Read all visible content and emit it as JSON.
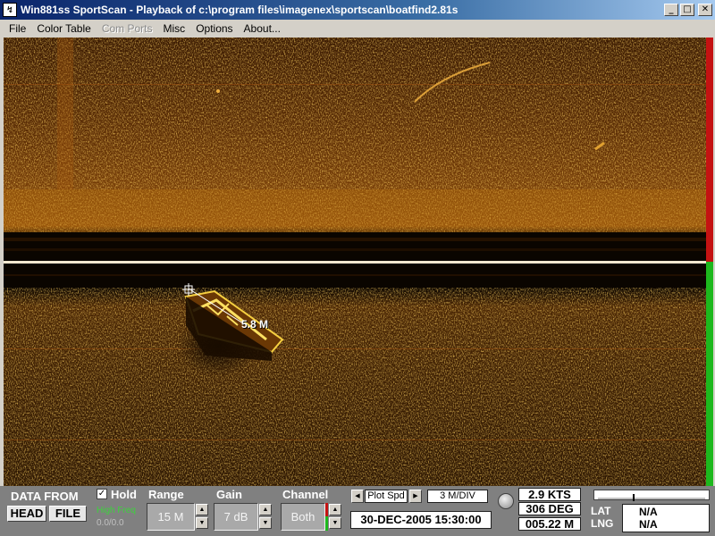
{
  "window": {
    "title": "Win881ss SportScan - Playback of c:\\program files\\imagenex\\sportscan\\boatfind2.81s",
    "min": "_",
    "max": "□",
    "close": "✕"
  },
  "menu": {
    "items": [
      {
        "label": "File"
      },
      {
        "label": "Color Table"
      },
      {
        "label": "Com Ports"
      },
      {
        "label": "Misc"
      },
      {
        "label": "Options"
      },
      {
        "label": "About..."
      }
    ]
  },
  "sonar": {
    "target_range": "5.8 M"
  },
  "panel": {
    "data_from": "DATA FROM",
    "head_button": "HEAD",
    "file_button": "FILE",
    "hold_label": "Hold",
    "hold_checked": "✓",
    "high_freq": "High Freq",
    "counter": "0.0/0.0",
    "range_label": "Range",
    "range_value": "15 M",
    "gain_label": "Gain",
    "gain_value": "7 dB",
    "channel_label": "Channel",
    "channel_value": "Both",
    "plot_label": "Plot Spd",
    "scale": "3 M/DIV",
    "datetime": "30-DEC-2005  15:30:00",
    "speed": "2.9 KTS",
    "heading": "306 DEG",
    "distance": "005.22 M",
    "lat_label": "LAT",
    "lng_label": "LNG",
    "lat_value": "N/A",
    "lng_value": "N/A",
    "spin_up": "▲",
    "spin_down": "▼",
    "arrow_left": "◀",
    "arrow_right": "▶"
  }
}
